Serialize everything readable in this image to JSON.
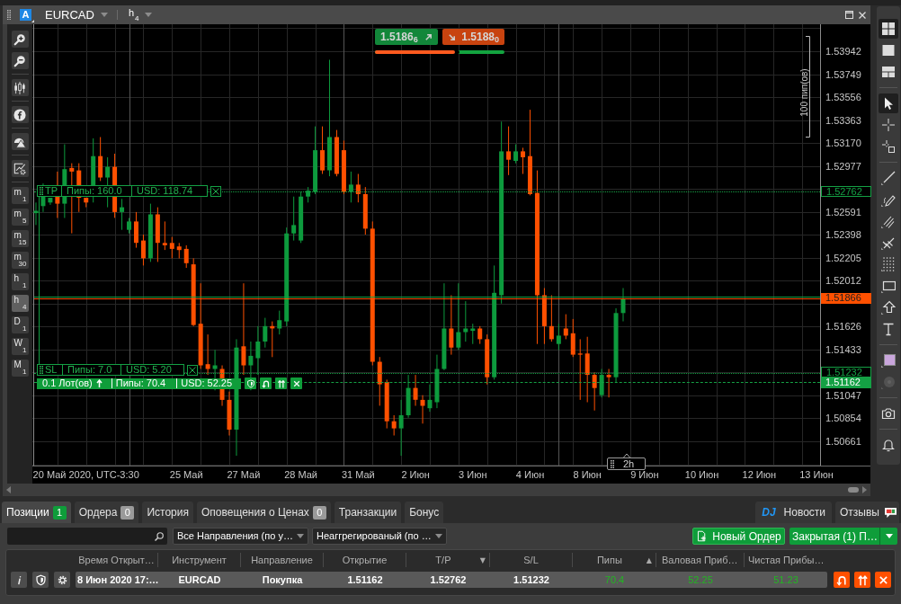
{
  "chart_window": {
    "group": "A",
    "symbol": "EURCAD",
    "timeframe": {
      "unit": "h",
      "count": "4"
    }
  },
  "left_toolbar": {
    "tool_groups": [
      {
        "tools": [
          {
            "kind": "zoomin"
          },
          {
            "kind": "zoomout"
          }
        ]
      },
      {
        "tools": [
          {
            "kind": "candles"
          }
        ]
      },
      {
        "tools": [
          {
            "kind": "function"
          }
        ]
      },
      {
        "tools": [
          {
            "kind": "shapes"
          }
        ]
      },
      {
        "tools": [
          {
            "kind": "settings"
          }
        ]
      }
    ],
    "timeframes": [
      {
        "unit": "m",
        "count": "1",
        "selected": false
      },
      {
        "unit": "m",
        "count": "5",
        "selected": false
      },
      {
        "unit": "m",
        "count": "15",
        "selected": false
      },
      {
        "unit": "m",
        "count": "30",
        "selected": false
      },
      {
        "unit": "h",
        "count": "1",
        "selected": false
      },
      {
        "unit": "h",
        "count": "4",
        "selected": true
      },
      {
        "unit": "D",
        "count": "1",
        "selected": false
      },
      {
        "unit": "W",
        "count": "1",
        "selected": false
      },
      {
        "unit": "M",
        "count": "1",
        "selected": false
      }
    ]
  },
  "chart": {
    "quotes": [
      {
        "kind": "up",
        "price": "1.5186$_{6}$"
      },
      {
        "kind": "down",
        "price": "1.5188$_{0}$"
      }
    ],
    "sentiment": {
      "level": 0.64
    },
    "trade_tags": [
      {
        "kind": "tp",
        "tag": "TP",
        "pips": "Пипы: 160.0",
        "usd": "USD: 118.74"
      },
      {
        "kind": "sl",
        "tag": "SL",
        "pips": "Пипы: 7.0",
        "usd": "USD: 5.20"
      },
      {
        "kind": "entry",
        "tag": "0.1 Лот(ов)",
        "pips": "Пипы: 70.4",
        "usd": "USD: 52.25"
      }
    ],
    "chart_data": [
      {
        "type": "candlestick",
        "grid": true,
        "categories": [
          null,
          null,
          null,
          null,
          null,
          null,
          null,
          "20 Май 2020, UTC-3:30",
          null,
          null,
          null,
          null,
          null,
          null,
          null,
          null,
          null,
          null,
          null,
          null,
          null,
          "25 Май",
          null,
          null,
          null,
          null,
          null,
          null,
          null,
          "27 Май",
          null,
          null,
          null,
          null,
          null,
          null,
          null,
          "28 Май",
          null,
          null,
          null,
          null,
          null,
          null,
          null,
          "31 Май",
          null,
          null,
          null,
          null,
          null,
          null,
          null,
          "2 Июн",
          null,
          null,
          null,
          null,
          null,
          null,
          null,
          "3 Июн",
          null,
          null,
          null,
          null,
          null,
          null,
          null,
          "4 Июн",
          null,
          null,
          null,
          null,
          null,
          null,
          null,
          "8 Июн",
          null,
          null,
          null,
          null,
          null,
          null,
          null,
          "9 Июн",
          null,
          null,
          null,
          null,
          null,
          null,
          null,
          "10 Июн",
          null,
          null,
          null,
          null,
          null,
          null,
          null,
          "12 Июн",
          null,
          null,
          null,
          null,
          null,
          null,
          null,
          "13 Июн"
        ],
        "ohlc": [
          [
            1.5258,
            1.5267,
            1.5248,
            1.526
          ],
          [
            1.5264,
            1.5283,
            1.5259,
            1.5272
          ],
          [
            1.5267,
            1.5271,
            1.5265,
            1.5271
          ],
          [
            1.5272,
            1.5293,
            1.5254,
            1.5266
          ],
          [
            1.5266,
            1.5316,
            1.5254,
            1.5295
          ],
          [
            1.5296,
            1.53,
            1.5241,
            1.5293
          ],
          [
            1.5294,
            1.53,
            1.5259,
            1.5271
          ],
          [
            1.5271,
            1.5271,
            1.5263,
            1.5267
          ],
          [
            1.5272,
            1.5321,
            1.5267,
            1.5306
          ],
          [
            1.5306,
            1.5322,
            1.5285,
            1.5288
          ],
          [
            1.5288,
            1.5305,
            1.5263,
            1.5297
          ],
          [
            1.5297,
            1.5308,
            1.5254,
            1.5259
          ],
          [
            1.5259,
            1.527,
            1.5244,
            1.5263
          ],
          [
            1.5244,
            1.5254,
            1.5241,
            1.5251
          ],
          [
            1.5251,
            1.5259,
            1.5229,
            1.5233
          ],
          [
            1.5235,
            1.524,
            1.5214,
            1.522
          ],
          [
            1.522,
            1.5266,
            1.5217,
            1.5257
          ],
          [
            1.5257,
            1.5263,
            1.5217,
            1.5233
          ],
          [
            1.5233,
            1.5251,
            1.5227,
            1.5231
          ],
          [
            1.5233,
            1.5238,
            1.522,
            1.5228
          ],
          [
            1.523,
            1.5233,
            1.522,
            1.5227
          ],
          [
            1.5228,
            1.5231,
            1.5212,
            1.5216
          ],
          [
            1.5215,
            1.522,
            1.5163,
            1.5164
          ],
          [
            1.5165,
            1.5199,
            1.5127,
            1.513
          ],
          [
            1.5131,
            1.5156,
            1.5122,
            1.5127
          ],
          [
            1.5127,
            1.5143,
            1.5109,
            1.513
          ],
          [
            1.5127,
            1.513,
            1.5096,
            1.5101
          ],
          [
            1.5101,
            1.5108,
            1.5071,
            1.5076
          ],
          [
            1.5076,
            1.5152,
            1.5054,
            1.5145
          ],
          [
            1.5146,
            1.5199,
            1.5122,
            1.513
          ],
          [
            1.513,
            1.515,
            1.5109,
            1.5138
          ],
          [
            1.5136,
            1.5163,
            1.5122,
            1.515
          ],
          [
            1.515,
            1.517,
            1.5145,
            1.5163
          ],
          [
            1.5163,
            1.5167,
            1.5137,
            1.5161
          ],
          [
            1.5161,
            1.5176,
            1.5156,
            1.5168
          ],
          [
            1.5167,
            1.5246,
            1.5163,
            1.5241
          ],
          [
            1.5241,
            1.5272,
            1.5235,
            1.5248
          ],
          [
            1.5235,
            1.5276,
            1.5233,
            1.5272
          ],
          [
            1.5272,
            1.528,
            1.5267,
            1.5277
          ],
          [
            1.5276,
            1.5331,
            1.5274,
            1.5311
          ],
          [
            1.5311,
            1.5331,
            1.5291,
            1.5294
          ],
          [
            1.5294,
            1.5387,
            1.5289,
            1.5322
          ],
          [
            1.5322,
            1.5328,
            1.5289,
            1.5291
          ],
          [
            1.5311,
            1.5319,
            1.5274,
            1.5276
          ],
          [
            1.5276,
            1.5293,
            1.5267,
            1.5282
          ],
          [
            1.5282,
            1.5291,
            1.5267,
            1.5274
          ],
          [
            1.5274,
            1.528,
            1.524,
            1.5245
          ],
          [
            1.5245,
            1.5251,
            1.513,
            1.5133
          ],
          [
            1.5133,
            1.5137,
            1.5096,
            1.5114
          ],
          [
            1.5116,
            1.5118,
            1.5077,
            1.5083
          ],
          [
            1.5083,
            1.5088,
            1.5071,
            1.5077
          ],
          [
            1.5077,
            1.5101,
            1.5054,
            1.5088
          ],
          [
            1.5088,
            1.5122,
            1.5086,
            1.5111
          ],
          [
            1.5111,
            1.5122,
            1.5096,
            1.5101
          ],
          [
            1.5101,
            1.5105,
            1.5081,
            1.5096
          ],
          [
            1.5094,
            1.5114,
            1.5091,
            1.5101
          ],
          [
            1.5099,
            1.5139,
            1.5094,
            1.5127
          ],
          [
            1.5127,
            1.5199,
            1.5126,
            1.5161
          ],
          [
            1.5161,
            1.5189,
            1.5139,
            1.5145
          ],
          [
            1.5145,
            1.5199,
            1.5143,
            1.5158
          ],
          [
            1.5158,
            1.5184,
            1.515,
            1.5161
          ],
          [
            1.5159,
            1.5165,
            1.5148,
            1.5161
          ],
          [
            1.5161,
            1.5163,
            1.5148,
            1.5152
          ],
          [
            1.5152,
            1.5156,
            1.5114,
            1.512
          ],
          [
            1.512,
            1.5214,
            1.5118,
            1.5191
          ],
          [
            1.5189,
            1.5335,
            1.5182,
            1.531
          ],
          [
            1.531,
            1.5331,
            1.529,
            1.5303
          ],
          [
            1.5302,
            1.5316,
            1.53,
            1.531
          ],
          [
            1.531,
            1.5313,
            1.5291,
            1.5305
          ],
          [
            1.5306,
            1.5345,
            1.5273,
            1.5274
          ],
          [
            1.5275,
            1.5294,
            1.5148,
            1.5189
          ],
          [
            1.5189,
            1.5195,
            1.5148,
            1.5163
          ],
          [
            1.5163,
            1.5189,
            1.515,
            1.5152
          ],
          [
            1.5148,
            1.5165,
            1.5143,
            1.5155
          ],
          [
            1.5161,
            1.5173,
            1.5152,
            1.5155
          ],
          [
            1.5157,
            1.5169,
            1.5137,
            1.5139
          ],
          [
            1.514,
            1.5152,
            1.5101,
            1.5139
          ],
          [
            1.514,
            1.5154,
            1.5099,
            1.5122
          ],
          [
            1.5122,
            1.5124,
            1.5092,
            1.5111
          ],
          [
            1.5105,
            1.5127,
            1.5103,
            1.5122
          ],
          [
            1.5122,
            1.5127,
            1.5103,
            1.512
          ],
          [
            1.512,
            1.5178,
            1.5116,
            1.5174
          ],
          [
            1.5174,
            1.5195,
            1.5167,
            1.5186
          ],
          null,
          null,
          null,
          null,
          null,
          null,
          null,
          null,
          null,
          null,
          null,
          null,
          null,
          null,
          null,
          null,
          null,
          null,
          null,
          null,
          null,
          null,
          null,
          null,
          null,
          null,
          null
        ],
        "ylim": [
          1.50457,
          1.54169
        ],
        "yticks": [
          1.53942,
          1.53749,
          1.53556,
          1.53363,
          {
            "value": 1.5317,
            "label": "1.53170"
          },
          1.52977,
          1.52591,
          1.52398,
          1.52205,
          1.52012,
          1.51626,
          1.51433,
          1.51047,
          1.50854,
          1.50661
        ],
        "ref_lines": [
          {
            "axis": "y",
            "value": 1.52762,
            "label": "1.52762",
            "color": "#14a044",
            "line_style": "dotted"
          },
          {
            "axis": "y",
            "value": 1.5188,
            "color": "#14a044",
            "line_style": "solid"
          },
          {
            "axis": "y",
            "value": 1.51866,
            "label": "1.51866",
            "color": "#ff5000",
            "line_style": "solid"
          },
          {
            "axis": "y",
            "value": 1.51232,
            "label": "1.51232",
            "color": "#14a044",
            "line_style": "dotted"
          },
          {
            "axis": "y",
            "value": 1.51162,
            "label": "1.51162",
            "color": "#14a044",
            "line_style": "dashed"
          }
        ],
        "annotations": [
          "100 пип(ов)",
          "2h"
        ]
      }
    ]
  },
  "right_toolbar": {
    "groups": [
      {
        "tools": [
          {
            "kind": "grid",
            "selected": true
          },
          {
            "kind": "single",
            "selected": false
          },
          {
            "kind": "rows",
            "selected": false
          }
        ]
      },
      {
        "tools": [
          {
            "kind": "pointer",
            "selected": true
          },
          {
            "kind": "crosshair",
            "selected": false
          },
          {
            "kind": "crossbox",
            "selected": false
          }
        ]
      },
      {
        "tools": [
          {
            "kind": "line",
            "selected": false
          },
          {
            "kind": "pencil",
            "selected": false
          },
          {
            "kind": "hatch",
            "selected": false
          },
          {
            "kind": "fork",
            "selected": false
          },
          {
            "kind": "dots",
            "selected": false
          },
          {
            "kind": "rectangle",
            "selected": false
          },
          {
            "kind": "arrow",
            "selected": false
          },
          {
            "kind": "text",
            "selected": false
          }
        ]
      },
      {
        "tools": [
          {
            "kind": "color",
            "color": "#c9a6dc",
            "disabled": false
          },
          {
            "kind": "circle",
            "disabled": true
          }
        ]
      },
      {
        "tools": [
          {
            "kind": "camera"
          }
        ]
      },
      {
        "tools": [
          {
            "kind": "bell"
          }
        ]
      }
    ]
  },
  "bottom_panel": {
    "tabs": [
      {
        "label": "Позиции",
        "count": "1",
        "color": "#0f9d3a",
        "selected": true
      },
      {
        "label": "Ордера",
        "count": "0",
        "color": "#9a9a9a",
        "selected": false
      },
      {
        "label": "История",
        "selected": false
      },
      {
        "label": "Оповещения о Ценах",
        "count": "0",
        "color": "#9a9a9a",
        "selected": false
      },
      {
        "label": "Транзакции",
        "selected": false
      },
      {
        "label": "Бонус",
        "selected": false
      }
    ],
    "side_tabs": [
      {
        "kind": "news",
        "logo": "DJ",
        "label": "Новости"
      },
      {
        "kind": "reviews",
        "label": "Отзывы"
      }
    ],
    "filters": {
      "direction": "Все Направления (по у…",
      "aggregation": "Неаггрегированый (по …"
    },
    "actions": {
      "new_order": "Новый Ордер",
      "close_menu": "Закрытая (1) П…"
    },
    "table": {
      "columns": [
        {
          "label": "Время Открыт…"
        },
        {
          "label": "Инструмент"
        },
        {
          "label": "Направление"
        },
        {
          "label": "Открытие"
        },
        {
          "label": "T/P",
          "sort_mark": "▼"
        },
        {
          "label": "S/L"
        },
        {
          "label": "Пипы",
          "sort_mark": "▲"
        },
        {
          "label": "Валовая Приб…"
        },
        {
          "label": "Чистая Прибы…"
        }
      ],
      "rows": [
        {
          "selected": true,
          "cells": [
            {
              "text": "8 Июн 2020 17:…"
            },
            {
              "text": "EURCAD"
            },
            {
              "text": "Покупка"
            },
            {
              "text": "1.51162"
            },
            {
              "text": "1.52762"
            },
            {
              "text": "1.51232"
            },
            {
              "text": "70.4",
              "color": "#22b622"
            },
            {
              "text": "52.25",
              "color": "#22b622"
            },
            {
              "text": "51.23",
              "color": "#22b622"
            }
          ]
        }
      ]
    }
  }
}
